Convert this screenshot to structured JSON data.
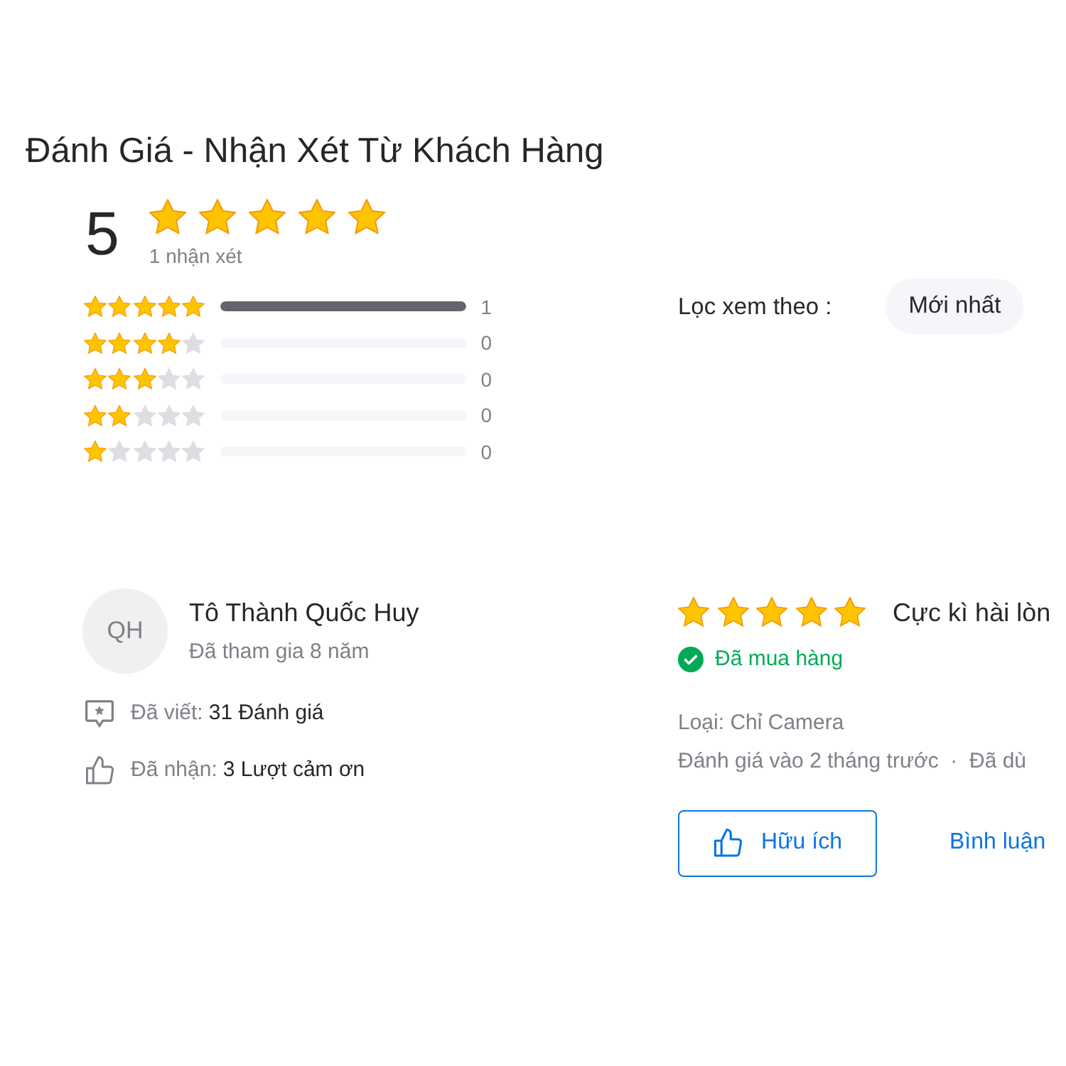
{
  "title": "Đánh Giá - Nhận Xét Từ Khách Hàng",
  "summary": {
    "score": "5",
    "stars": 5,
    "count_text": "1 nhận xét"
  },
  "distribution": [
    {
      "stars": 5,
      "level": 1,
      "count": "1"
    },
    {
      "stars": 4,
      "level": 0,
      "count": "0"
    },
    {
      "stars": 3,
      "level": 0,
      "count": "0"
    },
    {
      "stars": 2,
      "level": 0,
      "count": "0"
    },
    {
      "stars": 1,
      "level": 0,
      "count": "0"
    }
  ],
  "filter": {
    "label": "Lọc xem theo :",
    "options": [
      {
        "label": "Mới nhất",
        "selected": false
      }
    ]
  },
  "review": {
    "reviewer": {
      "initials": "QH",
      "name": "Tô Thành Quốc Huy",
      "joined": "Đã tham gia 8 năm",
      "stats": [
        {
          "kind": "written",
          "label": "Đã viết:",
          "value": "31 Đánh giá"
        },
        {
          "kind": "thanks",
          "label": "Đã nhận:",
          "value": "3 Lượt cảm ơn"
        }
      ]
    },
    "stars": 5,
    "headline": "Cực kì hài lòn",
    "purchased": true,
    "purchased_text": "Đã mua hàng",
    "variant": "Loại: Chỉ Camera",
    "meta": "Đánh giá vào 2 tháng trước  ·  Đã dù",
    "actions": [
      {
        "kind": "helpful",
        "label": "Hữu ích"
      },
      {
        "kind": "comment",
        "label": "Bình luận"
      }
    ]
  }
}
